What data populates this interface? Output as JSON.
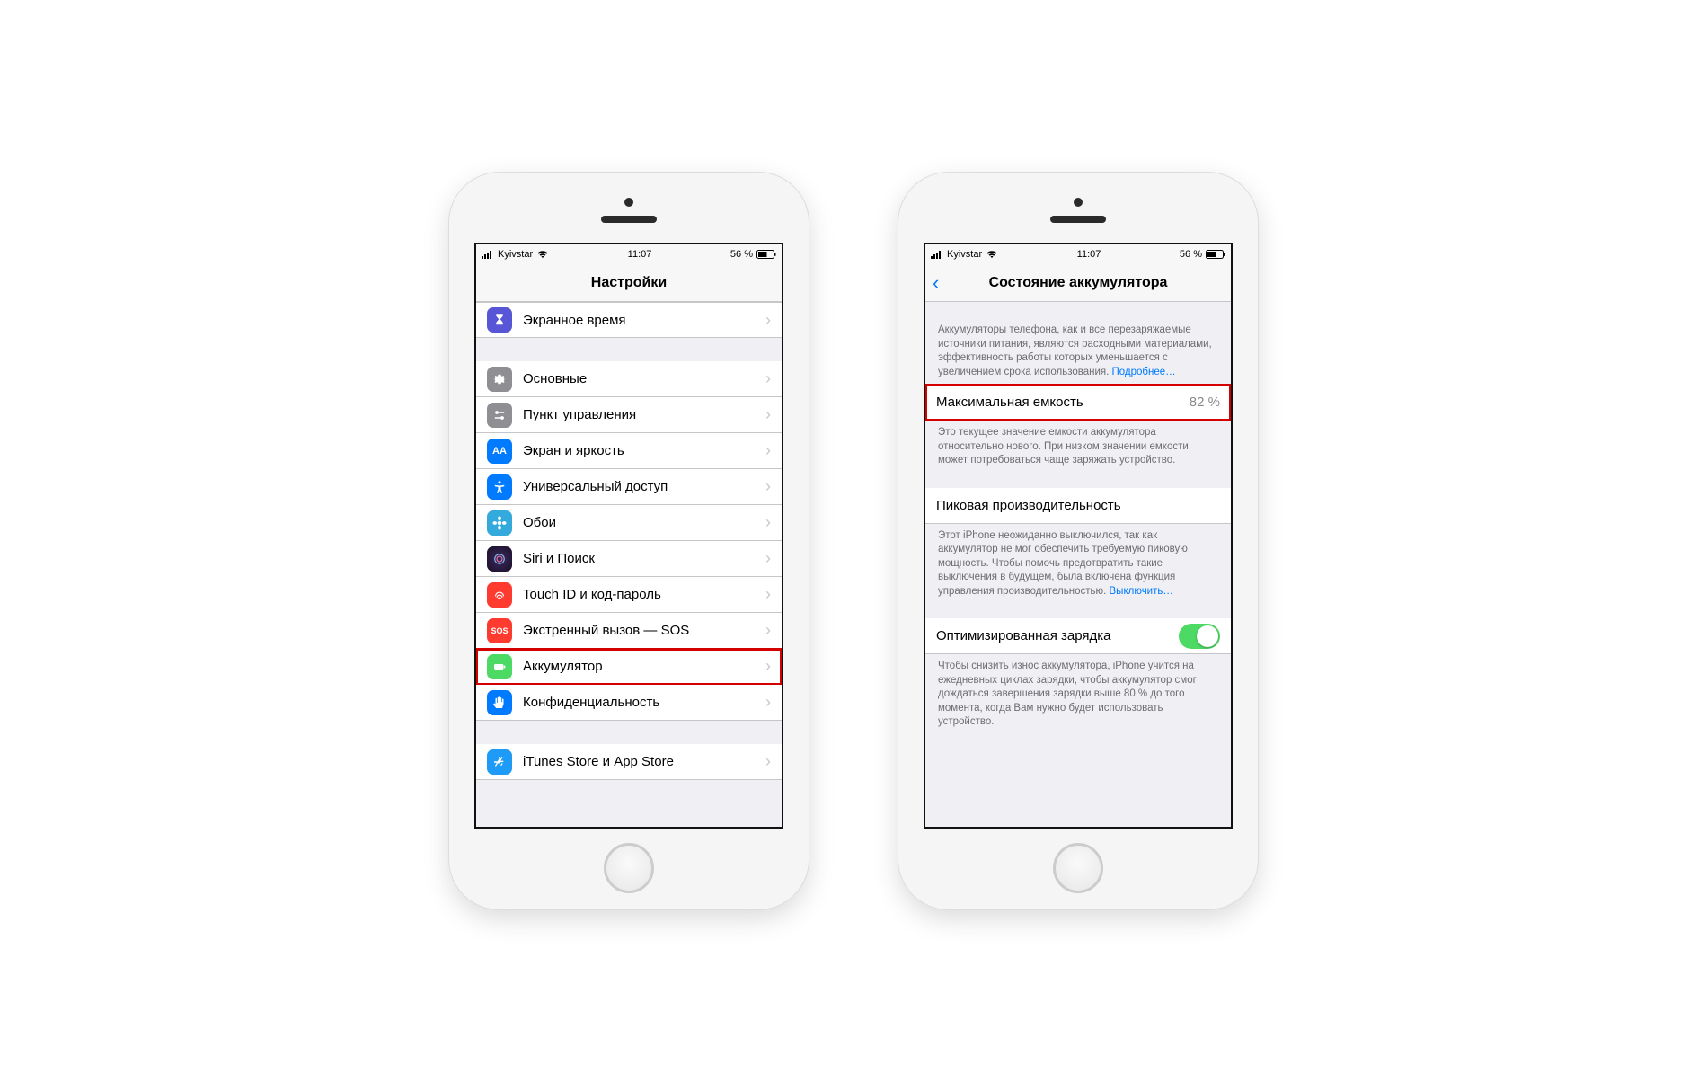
{
  "status": {
    "carrier": "Kyivstar",
    "time": "11:07",
    "battery_pct": "56 %"
  },
  "left": {
    "title": "Настройки",
    "rows": {
      "screentime": "Экранное время",
      "general": "Основные",
      "control_center": "Пункт управления",
      "display": "Экран и яркость",
      "accessibility": "Универсальный доступ",
      "wallpaper": "Обои",
      "siri": "Siri и Поиск",
      "touchid": "Touch ID и код-пароль",
      "sos": "Экстренный вызов — SOS",
      "battery": "Аккумулятор",
      "privacy": "Конфиденциальность",
      "appstore": "iTunes Store и App Store"
    }
  },
  "right": {
    "title": "Состояние аккумулятора",
    "intro": "Аккумуляторы телефона, как и все перезаряжаемые источники питания, являются расходными материалами, эффективность работы которых уменьшается с увеличением срока использования.",
    "more": "Подробнее…",
    "capacity_label": "Максимальная емкость",
    "capacity_value": "82 %",
    "capacity_footer": "Это текущее значение емкости аккумулятора относительно нового. При низком значении емкости может потребоваться чаще заряжать устройство.",
    "peak_label": "Пиковая производительность",
    "peak_footer_a": "Этот iPhone неожиданно выключился, так как аккумулятор не мог обеспечить требуемую пиковую мощность. Чтобы помочь предотвратить такие выключения в будущем, была включена функция управления производительностью. ",
    "peak_disable": "Выключить…",
    "optimized_label": "Оптимизированная зарядка",
    "optimized_footer": "Чтобы снизить износ аккумулятора, iPhone учится на ежедневных циклах зарядки, чтобы аккумулятор смог дождаться завершения зарядки выше 80 % до того момента, когда Вам нужно будет использовать устройство."
  }
}
